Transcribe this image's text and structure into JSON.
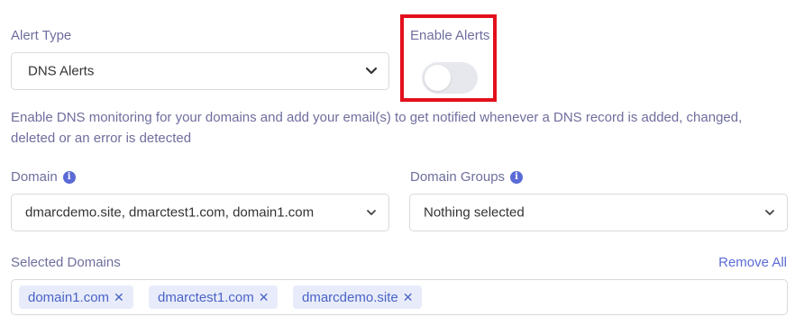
{
  "alert_type": {
    "label": "Alert Type",
    "value": "DNS Alerts"
  },
  "enable_alerts": {
    "label": "Enable Alerts",
    "enabled": false
  },
  "description": "Enable DNS monitoring for your domains and add your email(s) to get notified whenever a DNS record is added, changed, deleted or an error is detected",
  "domain": {
    "label": "Domain",
    "value": "dmarcdemo.site, dmarctest1.com, domain1.com",
    "info_icon": "i"
  },
  "domain_groups": {
    "label": "Domain Groups",
    "value": "Nothing selected",
    "info_icon": "i"
  },
  "selected_domains": {
    "label": "Selected Domains",
    "remove_all": "Remove All",
    "chips": [
      {
        "label": "domain1.com",
        "remove": "✕"
      },
      {
        "label": "dmarctest1.com",
        "remove": "✕"
      },
      {
        "label": "dmarcdemo.site",
        "remove": "✕"
      }
    ]
  },
  "colors": {
    "accent": "#5b6bd6",
    "highlight": "#e3101b",
    "label": "#6e6e9e"
  }
}
